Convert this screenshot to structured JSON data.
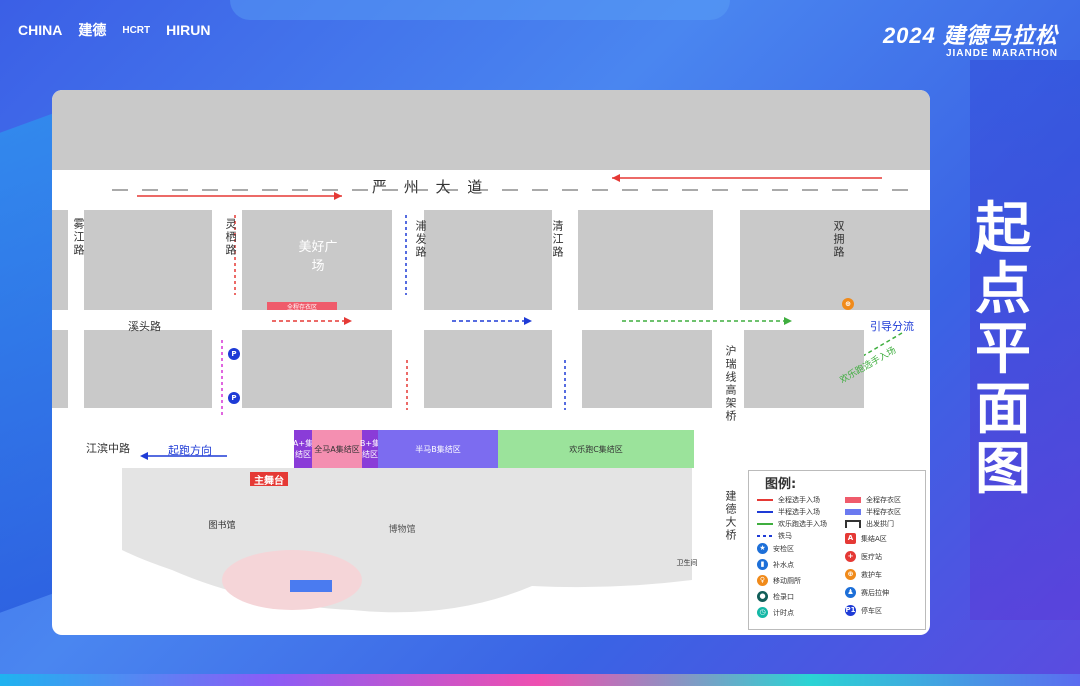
{
  "logos": [
    "CHINA",
    "建德",
    "HCRT",
    "HIRUN"
  ],
  "brand": {
    "year": "2024 建德马拉松",
    "en": "JIANDE MARATHON"
  },
  "side_title": [
    "起",
    "点",
    "平",
    "面",
    "图"
  ],
  "roads": {
    "main": "严 州 大 道",
    "wujiang": "雾江路",
    "lingqi": "灵栖路",
    "meihao": "美好广场",
    "pufa": "浦发路",
    "qingjiang": "清江路",
    "shuangyong": "双拥路",
    "xitou": "溪头路",
    "jiangbin": "江滨中路",
    "hurui": "沪瑞线高架桥",
    "jiande_bridge": "建德大桥",
    "guide": "引导分流",
    "fun_run_entry": "欢乐跑选手入场",
    "start_dir": "起跑方向"
  },
  "zones": {
    "a_plus": "A+集结区",
    "b_plus": "B+集结区",
    "full_a": "全马A集结区",
    "half_b": "半马B集结区",
    "fun_c": "欢乐跑C集结区",
    "stage": "主舞台",
    "library": "图书馆",
    "museum": "博物馆",
    "security": "安检区",
    "storage": "全程存衣区",
    "clinic": "卫生间"
  },
  "legend": {
    "title": "图例:",
    "items": [
      {
        "label": "全程选手入场",
        "color": "#e53935",
        "kind": "arrow"
      },
      {
        "label": "半程选手入场",
        "color": "#1e3bd6",
        "kind": "arrow"
      },
      {
        "label": "欢乐跑选手入场",
        "color": "#3fae3f",
        "kind": "arrow"
      },
      {
        "label": "铁马",
        "color": "#1e3bd6",
        "kind": "dash"
      },
      {
        "label": "安检区",
        "color": "#1d6fd8",
        "kind": "icon",
        "glyph": "★"
      },
      {
        "label": "补水点",
        "color": "#1d6fd8",
        "kind": "icon",
        "glyph": "▮"
      },
      {
        "label": "移动厕所",
        "color": "#f08a1a",
        "kind": "icon",
        "glyph": "♀"
      },
      {
        "label": "检录口",
        "color": "#115e59",
        "kind": "icon",
        "glyph": "●"
      },
      {
        "label": "计时点",
        "color": "#14b8a6",
        "kind": "icon",
        "glyph": "◷"
      },
      {
        "label": "全程存衣区",
        "color": "#ef5b6b",
        "kind": "swatch"
      },
      {
        "label": "半程存衣区",
        "color": "#6b7af0",
        "kind": "swatch"
      },
      {
        "label": "出发拱门",
        "color": "#333333",
        "kind": "arch"
      },
      {
        "label": "集结A区",
        "color": "#e53935",
        "kind": "icon",
        "glyph": "A"
      },
      {
        "label": "医疗站",
        "color": "#e53935",
        "kind": "icon",
        "glyph": "+"
      },
      {
        "label": "救护车",
        "color": "#f08a1a",
        "kind": "icon",
        "glyph": "⊕"
      },
      {
        "label": "赛后拉伸",
        "color": "#1d6fd8",
        "kind": "icon",
        "glyph": "♟"
      },
      {
        "label": "停车区",
        "color": "#1e3bd6",
        "kind": "icon",
        "glyph": "P1"
      }
    ]
  },
  "colors": {
    "full": "#e53935",
    "half": "#1e3bd6",
    "fun": "#3fae3f",
    "zone_a": "#f48fb1",
    "zone_b": "#7c6cf0",
    "zone_c": "#9be39b"
  }
}
